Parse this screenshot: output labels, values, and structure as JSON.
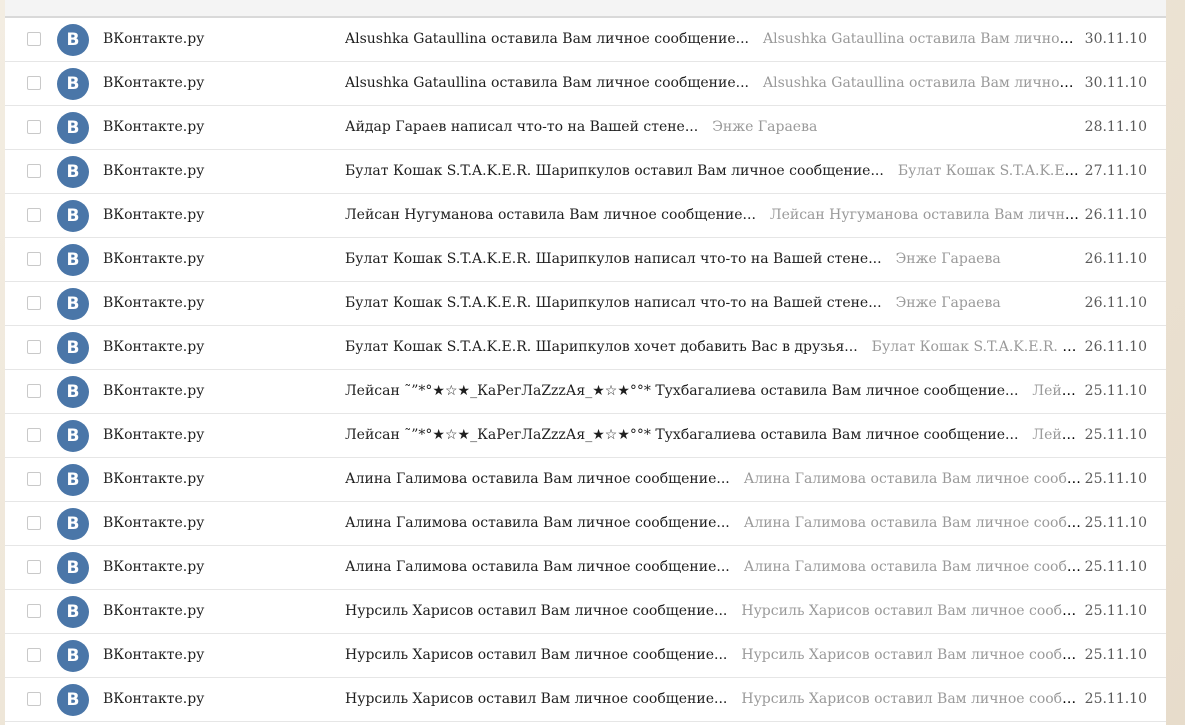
{
  "mail_list": {
    "rows": [
      {
        "sender": "ВКонтакте.ру",
        "avatar_letter": "B",
        "subject": "Alsushka Gataullina оставила Вам личное сообщение...",
        "snippet": "Alsushka Gataullina оставила Вам личное сообще...",
        "date": "30.11.10"
      },
      {
        "sender": "ВКонтакте.ру",
        "avatar_letter": "B",
        "subject": "Alsushka Gataullina оставила Вам личное сообщение...",
        "snippet": "Alsushka Gataullina оставила Вам личное сообще...",
        "date": "30.11.10"
      },
      {
        "sender": "ВКонтакте.ру",
        "avatar_letter": "B",
        "subject": "Айдар Гараев написал что-то на Вашей стене...",
        "snippet": "Энже Гараева",
        "date": "28.11.10"
      },
      {
        "sender": "ВКонтакте.ру",
        "avatar_letter": "B",
        "subject": "Булат Кошак S.T.A.K.E.R. Шарипкулов оставил Вам личное сообщение...",
        "snippet": "Булат Кошак S.T.A.K.E.R. Шар...",
        "date": "27.11.10"
      },
      {
        "sender": "ВКонтакте.ру",
        "avatar_letter": "B",
        "subject": "Лейсан Нугуманова оставила Вам личное сообщение...",
        "snippet": "Лейсан Нугуманова оставила Вам личное сообщ...",
        "date": "26.11.10"
      },
      {
        "sender": "ВКонтакте.ру",
        "avatar_letter": "B",
        "subject": "Булат Кошак S.T.A.K.E.R. Шарипкулов написал что-то на Вашей стене...",
        "snippet": "Энже Гараева",
        "date": "26.11.10"
      },
      {
        "sender": "ВКонтакте.ру",
        "avatar_letter": "B",
        "subject": "Булат Кошак S.T.A.K.E.R. Шарипкулов написал что-то на Вашей стене...",
        "snippet": "Энже Гараева",
        "date": "26.11.10"
      },
      {
        "sender": "ВКонтакте.ру",
        "avatar_letter": "B",
        "subject": "Булат Кошак S.T.A.K.E.R. Шарипкулов хочет добавить Вас в друзья...",
        "snippet": "Булат Кошак S.T.A.K.E.R. Шарипк...",
        "date": "26.11.10"
      },
      {
        "sender": "ВКонтакте.ру",
        "avatar_letter": "B",
        "subject": "Лейсан ˜”*°★☆★_КаРегЛаZzzАя_★☆★°°* Тухбагалиева оставила Вам личное сообщение...",
        "snippet": "Лейсан ˜”*°...",
        "date": "25.11.10"
      },
      {
        "sender": "ВКонтакте.ру",
        "avatar_letter": "B",
        "subject": "Лейсан ˜”*°★☆★_КаРегЛаZzzАя_★☆★°°* Тухбагалиева оставила Вам личное сообщение...",
        "snippet": "Лейсан ˜”*°...",
        "date": "25.11.10"
      },
      {
        "sender": "ВКонтакте.ру",
        "avatar_letter": "B",
        "subject": "Алина Галимова оставила Вам личное сообщение...",
        "snippet": "Алина Галимова оставила Вам личное сообщение.",
        "date": "25.11.10"
      },
      {
        "sender": "ВКонтакте.ру",
        "avatar_letter": "B",
        "subject": "Алина Галимова оставила Вам личное сообщение...",
        "snippet": "Алина Галимова оставила Вам личное сообщение.",
        "date": "25.11.10"
      },
      {
        "sender": "ВКонтакте.ру",
        "avatar_letter": "B",
        "subject": "Алина Галимова оставила Вам личное сообщение...",
        "snippet": "Алина Галимова оставила Вам личное сообщение.",
        "date": "25.11.10"
      },
      {
        "sender": "ВКонтакте.ру",
        "avatar_letter": "B",
        "subject": "Нурсиль Харисов оставил Вам личное сообщение...",
        "snippet": "Нурсиль Харисов оставил Вам личное сообщение.",
        "date": "25.11.10"
      },
      {
        "sender": "ВКонтакте.ру",
        "avatar_letter": "B",
        "subject": "Нурсиль Харисов оставил Вам личное сообщение...",
        "snippet": "Нурсиль Харисов оставил Вам личное сообщение.",
        "date": "25.11.10"
      },
      {
        "sender": "ВКонтакте.ру",
        "avatar_letter": "B",
        "subject": "Нурсиль Харисов оставил Вам личное сообщение...",
        "snippet": "Нурсиль Харисов оставил Вам личное сообщение.",
        "date": "25.11.10"
      }
    ]
  },
  "colors": {
    "avatar_bg": "#4a76a8",
    "subject_text": "#1f1f1f",
    "snippet_text": "#9a9a9a",
    "date_text": "#5a5a5a"
  }
}
